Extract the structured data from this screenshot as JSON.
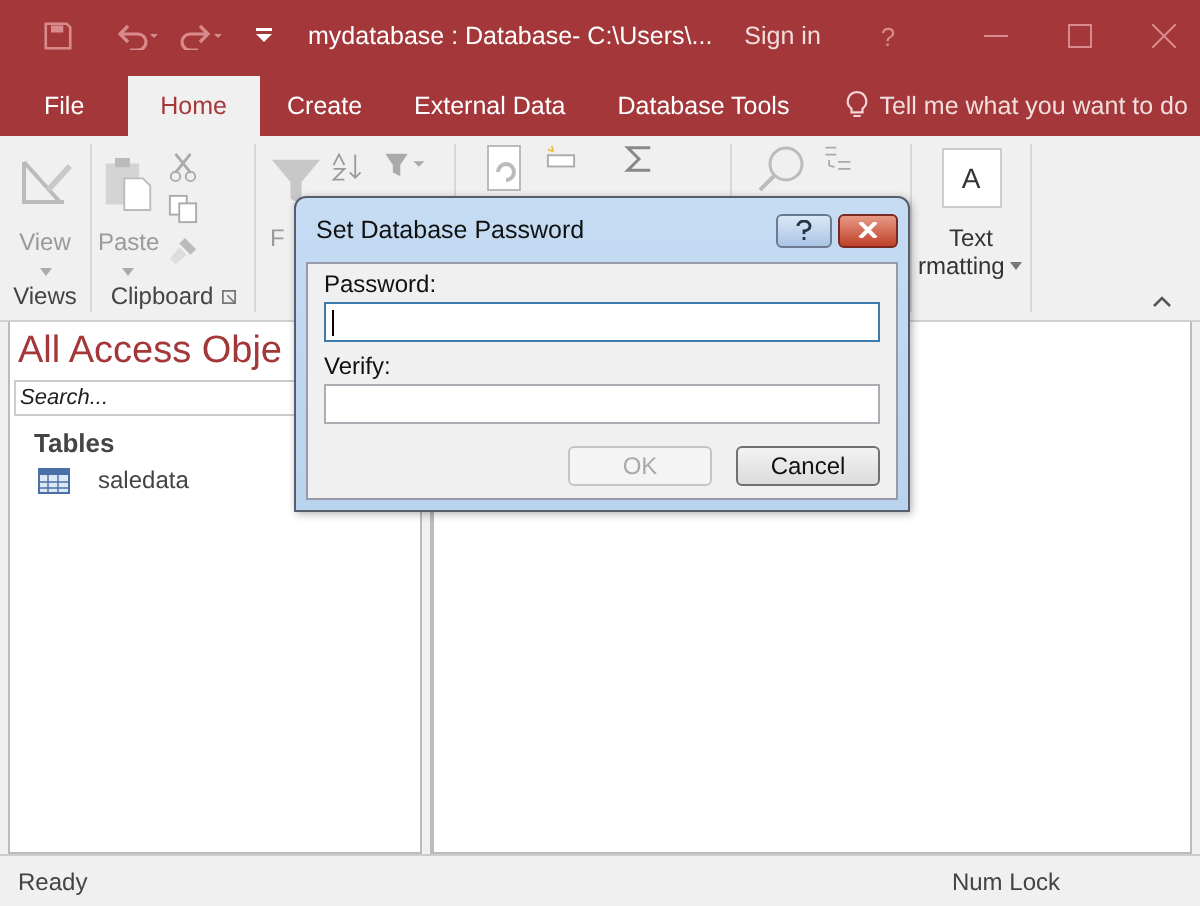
{
  "window": {
    "title": "mydatabase : Database- C:\\Users\\...",
    "sign_in": "Sign in",
    "help": "?"
  },
  "tabs": [
    {
      "label": "File",
      "selected": false
    },
    {
      "label": "Home",
      "selected": true
    },
    {
      "label": "Create",
      "selected": false
    },
    {
      "label": "External Data",
      "selected": false
    },
    {
      "label": "Database Tools",
      "selected": false
    }
  ],
  "tell_me": "Tell me what you want to do",
  "ribbon": {
    "view": "View",
    "views_group": "Views",
    "paste": "Paste",
    "clipboard_group": "Clipboard",
    "filter_partial": "F",
    "text_formatting_icon": "A",
    "text_label": "Text",
    "formatting_partial": "rmatting"
  },
  "nav_pane": {
    "title": "All Access Obje",
    "search_placeholder": "Search...",
    "groups": [
      {
        "label": "Tables",
        "items": [
          {
            "name": "saledata"
          }
        ]
      }
    ]
  },
  "dialog": {
    "title": "Set Database Password",
    "fields": [
      {
        "label": "Password:",
        "focused": true
      },
      {
        "label": "Verify:",
        "focused": false
      }
    ],
    "buttons": [
      {
        "label": "OK",
        "disabled": true
      },
      {
        "label": "Cancel",
        "disabled": false
      }
    ]
  },
  "status_bar": {
    "left": "Ready",
    "right": "Num Lock"
  }
}
